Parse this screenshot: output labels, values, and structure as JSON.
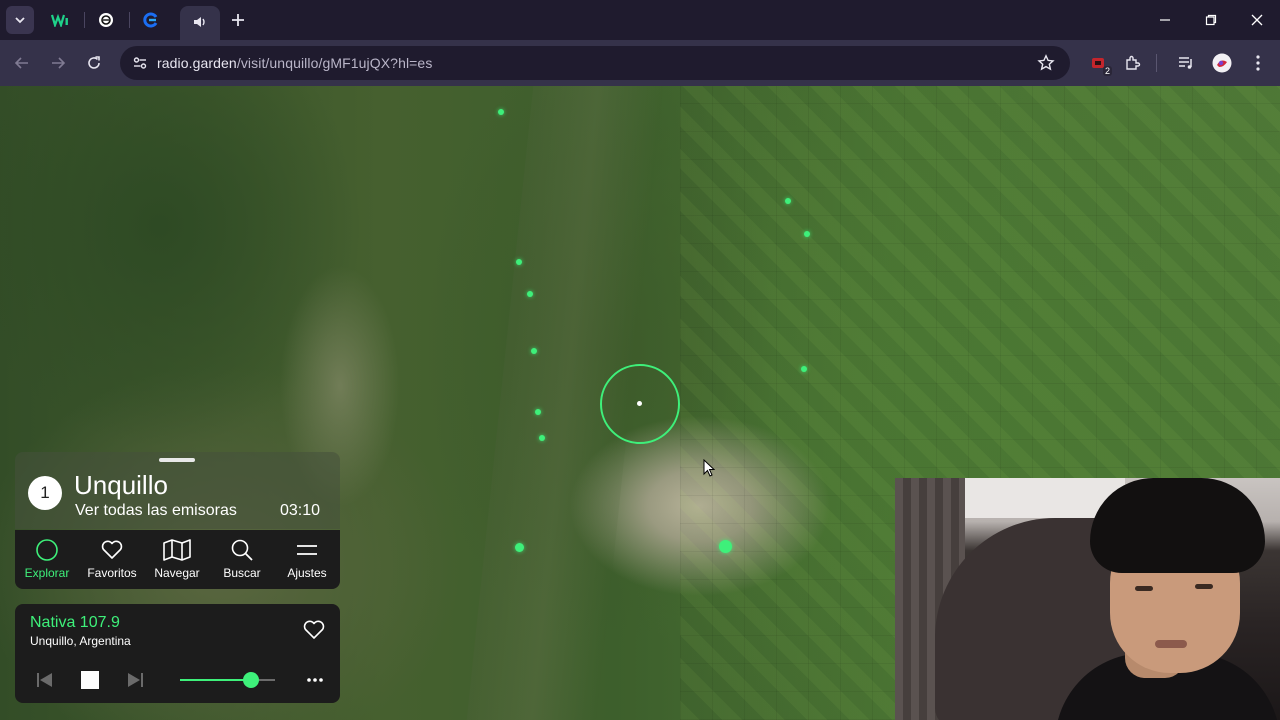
{
  "browser": {
    "url_host": "radio.garden",
    "url_path": "/visit/unquillo/gMF1ujQX?hl=es",
    "extension_badge": "2",
    "icons": [
      "tab-search-icon",
      "wix-icon",
      "chatgpt-icon",
      "edge-icon",
      "speaker-icon",
      "new-tab-icon",
      "back-icon",
      "forward-icon",
      "reload-icon",
      "site-info-icon",
      "star-icon",
      "extension-icon",
      "puzzle-icon",
      "media-control-icon",
      "profile-icon",
      "kebab-icon"
    ]
  },
  "panel": {
    "station_count": "1",
    "place_name": "Unquillo",
    "see_all": "Ver todas las emisoras",
    "local_time": "03:10"
  },
  "nav": {
    "items": [
      {
        "label": "Explorar",
        "icon": "circle-icon",
        "active": true
      },
      {
        "label": "Favoritos",
        "icon": "heart-icon",
        "active": false
      },
      {
        "label": "Navegar",
        "icon": "map-icon",
        "active": false
      },
      {
        "label": "Buscar",
        "icon": "search-icon",
        "active": false
      },
      {
        "label": "Ajustes",
        "icon": "menu-icon",
        "active": false
      }
    ]
  },
  "player": {
    "station_name": "Nativa 107.9",
    "location": "Unquillo, Argentina",
    "volume": 0.75
  },
  "colors": {
    "accent": "#3ef07a",
    "panel_bg": "#1c1c1c",
    "chrome_dark": "#1f1b2e",
    "chrome_toolbar": "#35324a"
  }
}
